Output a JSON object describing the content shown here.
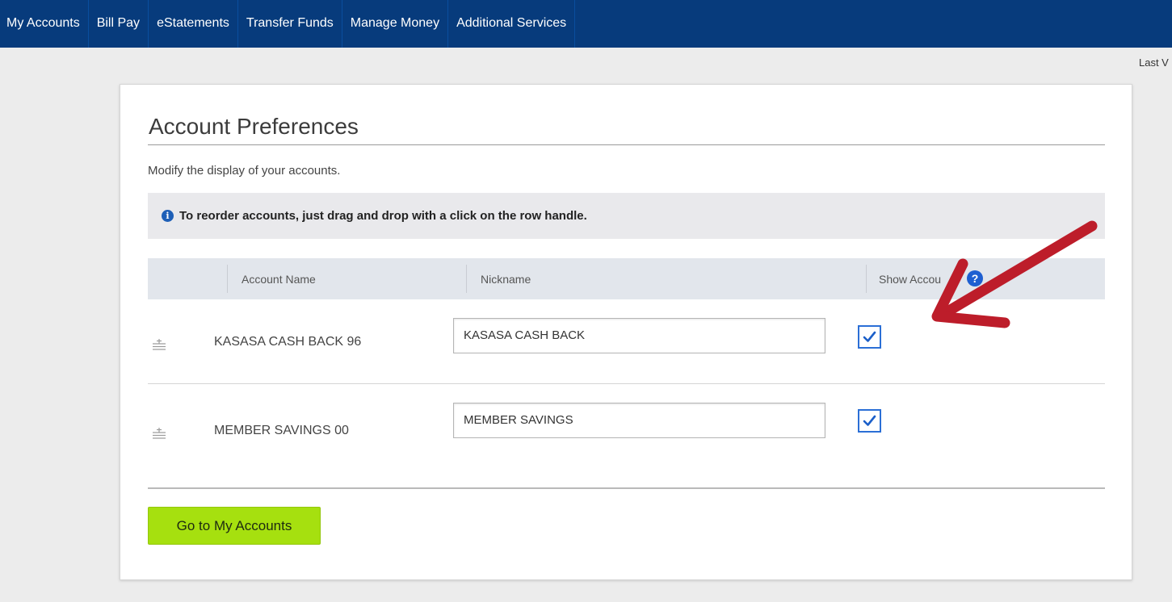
{
  "nav": {
    "items": [
      {
        "label": "My Accounts"
      },
      {
        "label": "Bill Pay"
      },
      {
        "label": "eStatements"
      },
      {
        "label": "Transfer Funds"
      },
      {
        "label": "Manage Money"
      },
      {
        "label": "Additional Services"
      }
    ]
  },
  "last_visit_text": "Last V",
  "page": {
    "title": "Account Preferences",
    "subtitle": "Modify the display of your accounts.",
    "info_message": "To reorder accounts, just drag and drop with a click on the row handle."
  },
  "table": {
    "headers": {
      "account_name": "Account Name",
      "nickname": "Nickname",
      "show_account": "Show Accou"
    },
    "rows": [
      {
        "account_name": "KASASA CASH BACK  96",
        "nickname": "KASASA CASH BACK",
        "show": true
      },
      {
        "account_name": "MEMBER SAVINGS  00",
        "nickname": "MEMBER SAVINGS",
        "show": true
      }
    ]
  },
  "buttons": {
    "go_to_accounts": "Go to My Accounts"
  },
  "icons": {
    "info": "info-circle-icon",
    "help": "question-circle-icon",
    "handle": "drag-handle-icon",
    "check": "checkmark-icon",
    "annotation": "red-arrow-annotation"
  },
  "colors": {
    "nav_bg": "#073b7c",
    "button_bg": "#a6e00f",
    "checkbox_border": "#2b6fd6",
    "arrow": "#bd1d2a"
  }
}
